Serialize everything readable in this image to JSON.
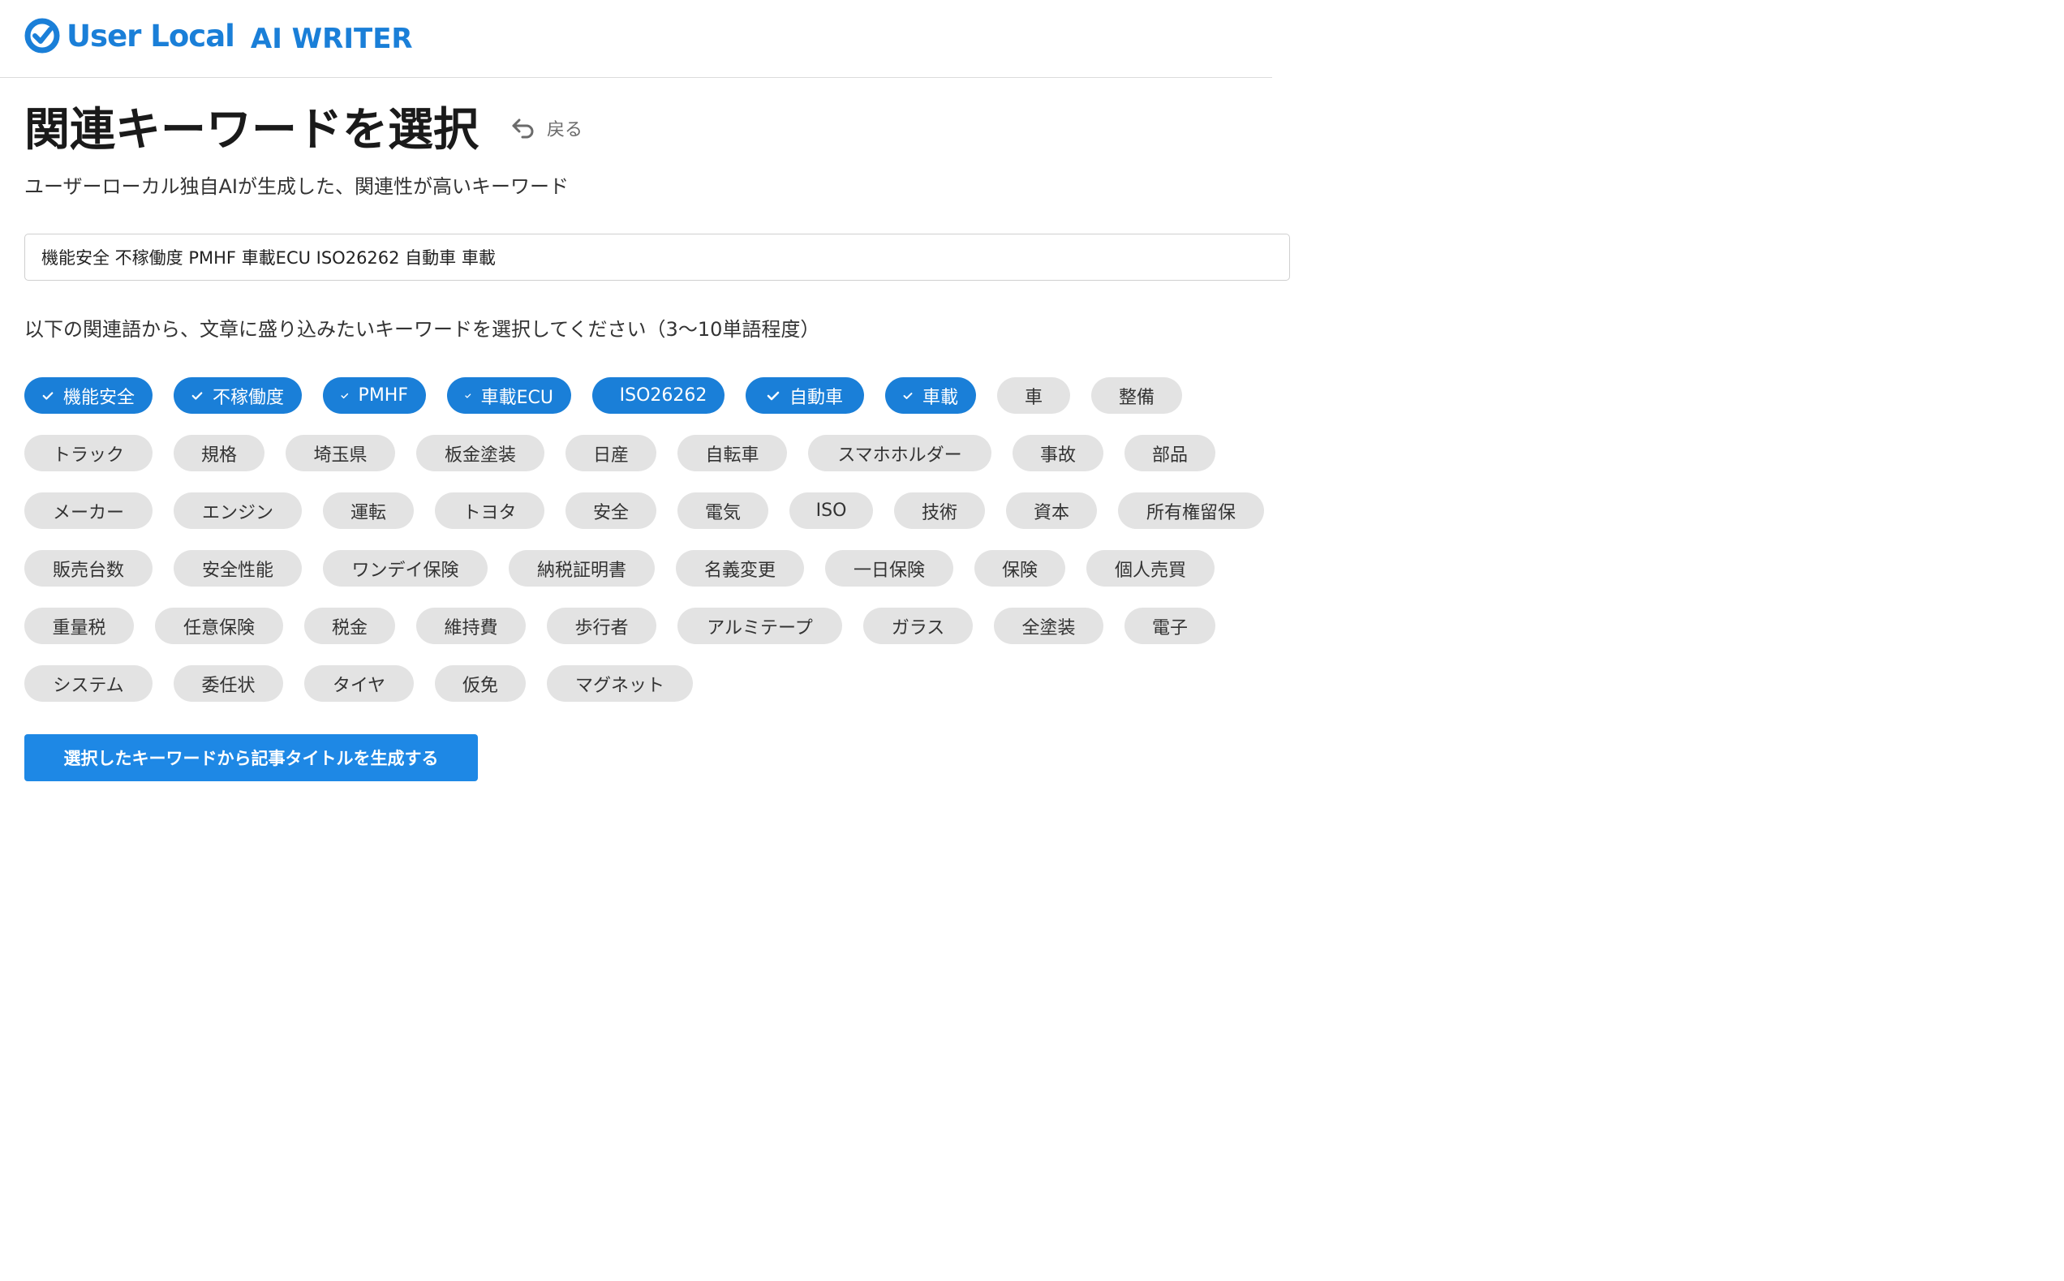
{
  "header": {
    "logo_text": "User Local",
    "product": "AI WRITER"
  },
  "page": {
    "title": "関連キーワードを選択",
    "back_label": "戻る",
    "subtitle": "ユーザーローカル独自AIが生成した、関連性が高いキーワード",
    "input_value": "機能安全 不稼働度 PMHF 車載ECU ISO26262 自動車 車載",
    "instruction": "以下の関連語から、文章に盛り込みたいキーワードを選択してください（3〜10単語程度）",
    "generate_label": "選択したキーワードから記事タイトルを生成する"
  },
  "tags": [
    [
      {
        "label": "機能安全",
        "selected": true
      },
      {
        "label": "不稼働度",
        "selected": true
      },
      {
        "label": "PMHF",
        "selected": true
      },
      {
        "label": "車載ECU",
        "selected": true
      },
      {
        "label": "ISO26262",
        "selected": true
      },
      {
        "label": "自動車",
        "selected": true
      },
      {
        "label": "車載",
        "selected": true
      },
      {
        "label": "車",
        "selected": false
      },
      {
        "label": "整備",
        "selected": false
      }
    ],
    [
      {
        "label": "トラック",
        "selected": false
      },
      {
        "label": "規格",
        "selected": false
      },
      {
        "label": "埼玉県",
        "selected": false
      },
      {
        "label": "板金塗装",
        "selected": false
      },
      {
        "label": "日産",
        "selected": false
      },
      {
        "label": "自転車",
        "selected": false
      },
      {
        "label": "スマホホルダー",
        "selected": false
      },
      {
        "label": "事故",
        "selected": false
      },
      {
        "label": "部品",
        "selected": false
      }
    ],
    [
      {
        "label": "メーカー",
        "selected": false
      },
      {
        "label": "エンジン",
        "selected": false
      },
      {
        "label": "運転",
        "selected": false
      },
      {
        "label": "トヨタ",
        "selected": false
      },
      {
        "label": "安全",
        "selected": false
      },
      {
        "label": "電気",
        "selected": false
      },
      {
        "label": "ISO",
        "selected": false
      },
      {
        "label": "技術",
        "selected": false
      },
      {
        "label": "資本",
        "selected": false
      },
      {
        "label": "所有権留保",
        "selected": false
      }
    ],
    [
      {
        "label": "販売台数",
        "selected": false
      },
      {
        "label": "安全性能",
        "selected": false
      },
      {
        "label": "ワンデイ保険",
        "selected": false
      },
      {
        "label": "納税証明書",
        "selected": false
      },
      {
        "label": "名義変更",
        "selected": false
      },
      {
        "label": "一日保険",
        "selected": false
      },
      {
        "label": "保険",
        "selected": false
      },
      {
        "label": "個人売買",
        "selected": false
      }
    ],
    [
      {
        "label": "重量税",
        "selected": false
      },
      {
        "label": "任意保険",
        "selected": false
      },
      {
        "label": "税金",
        "selected": false
      },
      {
        "label": "維持費",
        "selected": false
      },
      {
        "label": "歩行者",
        "selected": false
      },
      {
        "label": "アルミテープ",
        "selected": false
      },
      {
        "label": "ガラス",
        "selected": false
      },
      {
        "label": "全塗装",
        "selected": false
      },
      {
        "label": "電子",
        "selected": false
      }
    ],
    [
      {
        "label": "システム",
        "selected": false
      },
      {
        "label": "委任状",
        "selected": false
      },
      {
        "label": "タイヤ",
        "selected": false
      },
      {
        "label": "仮免",
        "selected": false
      },
      {
        "label": "マグネット",
        "selected": false
      }
    ]
  ],
  "colors": {
    "brand": "#1a7fd8",
    "tag_selected": "#1a7fd8",
    "tag_default": "#e3e3e3",
    "button": "#1e88e5"
  }
}
